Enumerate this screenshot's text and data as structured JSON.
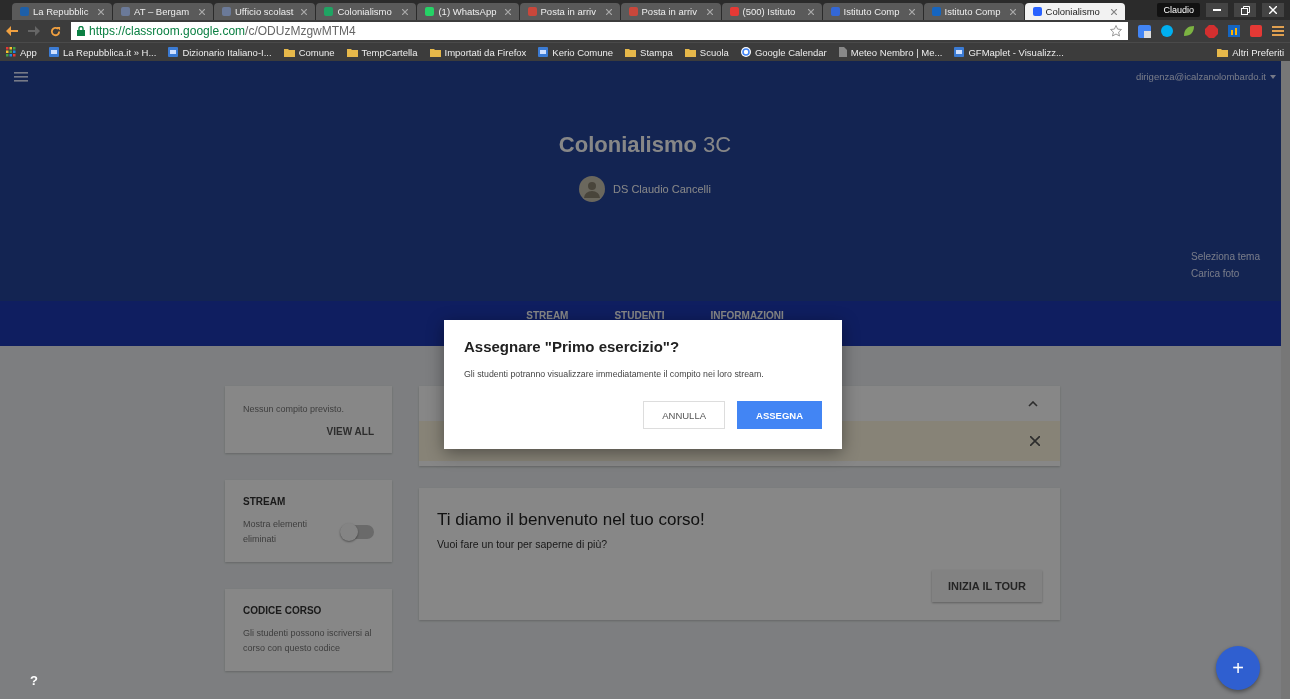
{
  "browser": {
    "tabs": [
      {
        "label": "La Repubblic",
        "kind": "news",
        "selected": false
      },
      {
        "label": "AT – Bergam",
        "kind": "page",
        "selected": false
      },
      {
        "label": "Ufficio scolast",
        "kind": "page",
        "selected": false
      },
      {
        "label": "Colonialismo",
        "kind": "drive",
        "selected": false
      },
      {
        "label": "(1) WhatsApp",
        "kind": "chat",
        "selected": false
      },
      {
        "label": "Posta in arriv",
        "kind": "mail",
        "selected": false
      },
      {
        "label": "Posta in arriv",
        "kind": "mail",
        "selected": false
      },
      {
        "label": "(500) Istituto",
        "kind": "video",
        "selected": false
      },
      {
        "label": "Istituto Comp",
        "kind": "calendar",
        "selected": false
      },
      {
        "label": "Istituto Comp",
        "kind": "blog",
        "selected": false
      },
      {
        "label": "Colonialismo",
        "kind": "classroom",
        "selected": true
      }
    ],
    "profile": "Claudio",
    "url_host": "https://classroom.google.com",
    "url_path": "/c/ODUzMzgwMTM4",
    "bookmarks": [
      {
        "kind": "apps",
        "label": "App"
      },
      {
        "kind": "site",
        "label": "La Repubblica.it » H..."
      },
      {
        "kind": "site",
        "label": "Dizionario Italiano-I..."
      },
      {
        "kind": "folder",
        "label": "Comune"
      },
      {
        "kind": "folder",
        "label": "TempCartella"
      },
      {
        "kind": "folder",
        "label": "Importati da Firefox"
      },
      {
        "kind": "site",
        "label": "Kerio Comune"
      },
      {
        "kind": "folder",
        "label": "Stampa"
      },
      {
        "kind": "folder",
        "label": "Scuola"
      },
      {
        "kind": "google",
        "label": "Google Calendar"
      },
      {
        "kind": "page",
        "label": "Meteo Nembro | Me..."
      },
      {
        "kind": "site",
        "label": "GFMaplet - Visualizz..."
      }
    ],
    "other_bookmarks": "Altri Preferiti"
  },
  "header": {
    "account": "dirigenza@icalzanolombardo.it",
    "course_title": "**Colonialismo** 3C",
    "teacher": "DS Claudio Cancelli",
    "links": [
      "Seleziona tema",
      "Carica foto"
    ]
  },
  "nav": [
    "STREAM",
    "STUDENTI",
    "INFORMAZIONI"
  ],
  "sidebar": {
    "upcoming": {
      "text": "Nessun compito previsto.",
      "action": "VIEW ALL"
    },
    "stream": {
      "title": "STREAM",
      "toggle_label": "Mostra elementi eliminati",
      "on": false
    },
    "code": {
      "title": "CODICE CORSO",
      "text": "Gli studenti possono iscriversi al corso con questo codice"
    }
  },
  "welcome": {
    "title": "Ti diamo il benvenuto nel tuo corso!",
    "text": "Vuoi fare un tour per saperne di più?",
    "action": "INIZIA IL TOUR"
  },
  "help": "?",
  "fab": "+",
  "dialog": {
    "title": "Assegnare \"Primo esercizio\"?",
    "text": "Gli studenti potranno visualizzare immediatamente il compito nei loro stream.",
    "buttons": [
      {
        "label": "ANNULLA",
        "kind": "secondary"
      },
      {
        "label": "ASSEGNA",
        "kind": "primary"
      }
    ]
  }
}
